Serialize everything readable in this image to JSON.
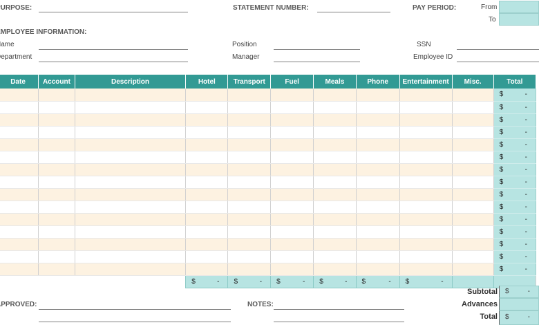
{
  "header": {
    "purpose_label": "PURPOSE:",
    "statement_number_label": "STATEMENT NUMBER:",
    "pay_period_label": "PAY PERIOD:",
    "from_label": "From",
    "to_label": "To",
    "employee_info_label": "EMPLOYEE INFORMATION:",
    "name_label": "Name",
    "department_label": "Department",
    "position_label": "Position",
    "manager_label": "Manager",
    "ssn_label": "SSN",
    "employee_id_label": "Employee ID"
  },
  "table": {
    "columns": [
      "Date",
      "Account",
      "Description",
      "Hotel",
      "Transport",
      "Fuel",
      "Meals",
      "Phone",
      "Entertainment",
      "Misc.",
      "Total"
    ],
    "row_count": 15,
    "currency_symbol": "$",
    "empty_value": "-"
  },
  "footer": {
    "approved_label": "APPROVED:",
    "notes_label": "NOTES:",
    "subtotal_label": "Subtotal",
    "advances_label": "Advances",
    "total_label": "Total"
  },
  "colors": {
    "header_teal": "#329a94",
    "total_fill": "#b7e4e2",
    "row_band": "#fdf2e1"
  }
}
